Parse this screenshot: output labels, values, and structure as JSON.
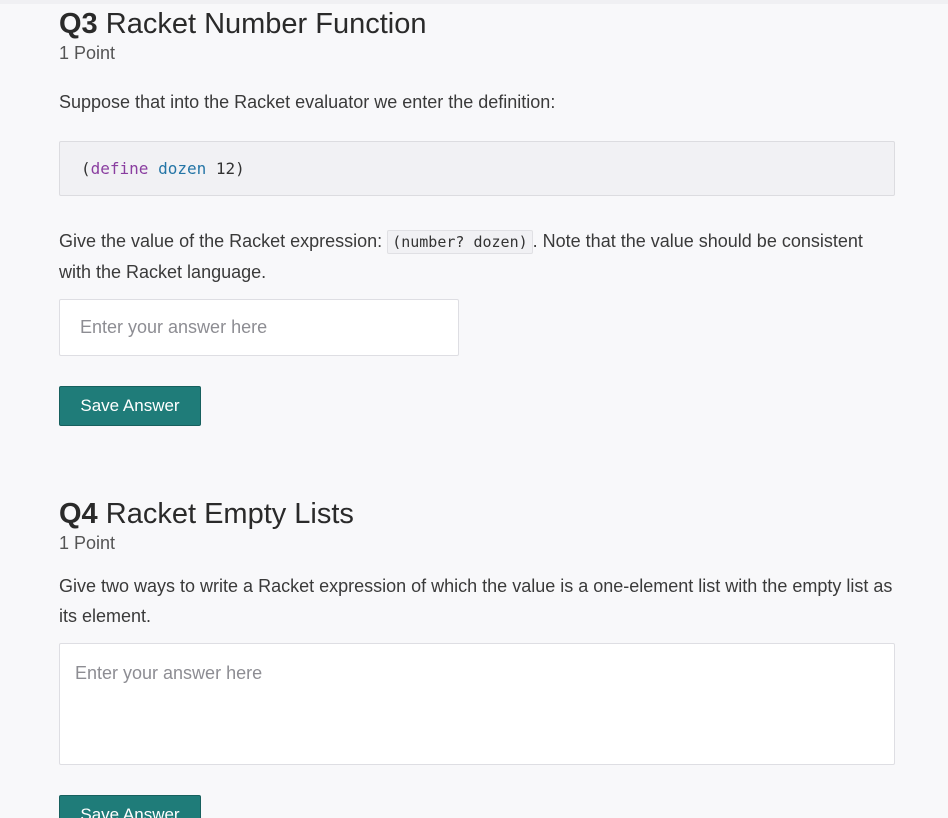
{
  "questions": [
    {
      "number": "Q3",
      "title": "Racket Number Function",
      "points": "1 Point",
      "prompt": "Suppose that into the Racket evaluator we enter the definition:",
      "code": {
        "open": "(",
        "keyword": "define",
        "name": "dozen",
        "value": "12",
        "close": ")"
      },
      "prompt2_before": "Give the value of the Racket expression: ",
      "inline_code": "(number? dozen)",
      "prompt2_after": ". Note that the value should be consistent with the Racket language.",
      "answer_placeholder": "Enter your answer here",
      "answer_value": "",
      "save_label": "Save Answer"
    },
    {
      "number": "Q4",
      "title": "Racket Empty Lists",
      "points": "1 Point",
      "prompt": "Give two ways to write a Racket expression of which the value is a one-element list with the empty list as its element.",
      "answer_placeholder": "Enter your answer here",
      "answer_value": "",
      "save_label": "Save Answer"
    }
  ],
  "colors": {
    "accent": "#1f7c79",
    "background": "#f8f8fa",
    "code_keyword": "#8a3ea0",
    "code_name": "#2475a6"
  }
}
